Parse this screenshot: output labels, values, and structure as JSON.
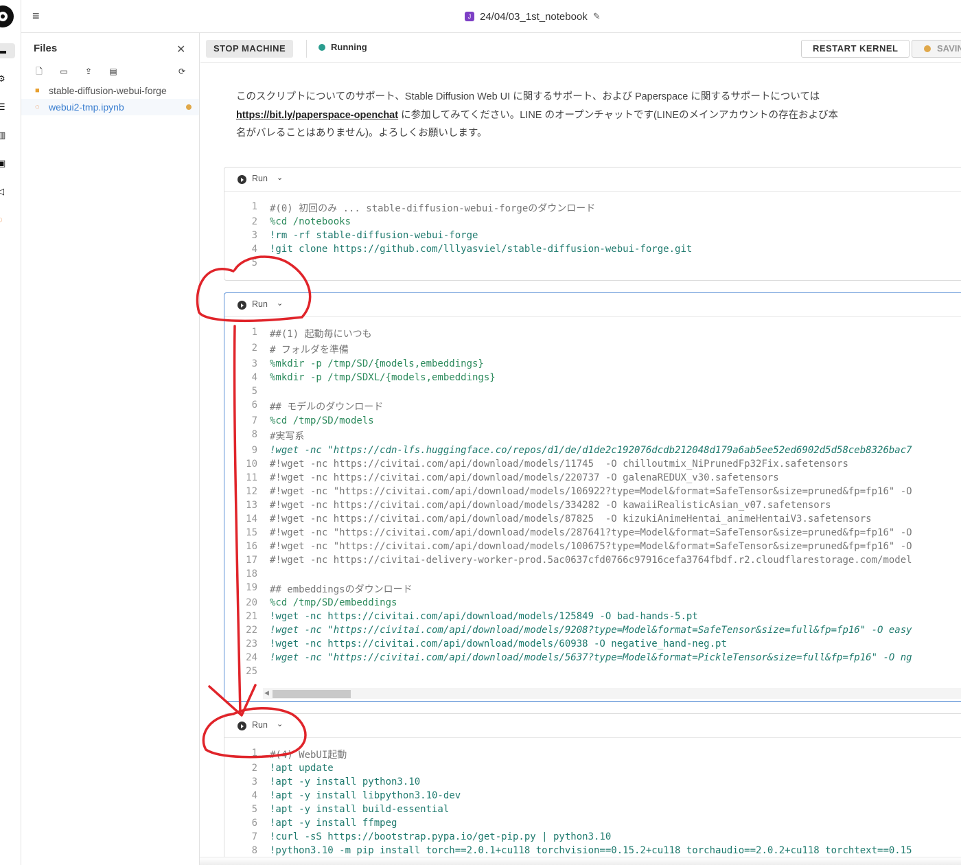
{
  "header": {
    "notebook_badge": "J",
    "notebook_title": "24/04/03_1st_notebook"
  },
  "rail": {
    "icons": [
      "files-icon",
      "cpu-icon",
      "layers-icon",
      "metrics-icon",
      "terminal-icon",
      "vscode-icon",
      "jupyter-icon"
    ]
  },
  "files": {
    "title": "Files",
    "items": [
      {
        "name": "stable-diffusion-webui-forge",
        "type": "folder"
      },
      {
        "name": "webui2-tmp.ipynb",
        "type": "notebook",
        "unsaved": true
      }
    ]
  },
  "toolbar": {
    "stop_label": "STOP MACHINE",
    "status_label": "Running",
    "restart_label": "RESTART KERNEL",
    "save_label": "SAVING"
  },
  "markdown": {
    "line1": "このスクリプトについてのサポート、Stable Diffusion Web UI に関するサポート、および Paperspace に関するサポートについては",
    "link": "https://bit.ly/paperspace-openchat",
    "line2_rest": " に参加してみてください。LINE のオープンチャットです(LINEのメインアカウントの存在および本",
    "line3": "名がバレることはありません)。よろしくお願いします。"
  },
  "cells": [
    {
      "run_label": "Run",
      "lines": [
        {
          "n": "1",
          "t": "#(0) 初回のみ ... stable-diffusion-webui-forgeのダウンロード",
          "k": "comment"
        },
        {
          "n": "2",
          "t": "%cd /notebooks",
          "k": "magic"
        },
        {
          "n": "3",
          "t": "!rm -rf stable-diffusion-webui-forge",
          "k": "bang"
        },
        {
          "n": "4",
          "t": "!git clone https://github.com/lllyasviel/stable-diffusion-webui-forge.git",
          "k": "bang"
        },
        {
          "n": "5",
          "t": "",
          "k": ""
        }
      ]
    },
    {
      "run_label": "Run",
      "lines": [
        {
          "n": "1",
          "t": "##(1) 起動毎にいつも",
          "k": "comment"
        },
        {
          "n": "2",
          "t": "# フォルダを準備",
          "k": "comment"
        },
        {
          "n": "3",
          "t": "%mkdir -p /tmp/SD/{models,embeddings}",
          "k": "magic"
        },
        {
          "n": "4",
          "t": "%mkdir -p /tmp/SDXL/{models,embeddings}",
          "k": "magic"
        },
        {
          "n": "5",
          "t": "",
          "k": ""
        },
        {
          "n": "6",
          "t": "## モデルのダウンロード",
          "k": "comment"
        },
        {
          "n": "7",
          "t": "%cd /tmp/SD/models",
          "k": "magic"
        },
        {
          "n": "8",
          "t": "#実写系",
          "k": "comment"
        },
        {
          "n": "9",
          "t": "!wget -nc \"https://cdn-lfs.huggingface.co/repos/d1/de/d1de2c192076dcdb212048d179a6ab5ee52ed6902d5d58ceb8326bac7",
          "k": "italic"
        },
        {
          "n": "10",
          "t": "#!wget -nc https://civitai.com/api/download/models/11745  -O chilloutmix_NiPrunedFp32Fix.safetensors",
          "k": "comment"
        },
        {
          "n": "11",
          "t": "#!wget -nc https://civitai.com/api/download/models/220737 -O galenaREDUX_v30.safetensors",
          "k": "comment"
        },
        {
          "n": "12",
          "t": "#!wget -nc \"https://civitai.com/api/download/models/106922?type=Model&format=SafeTensor&size=pruned&fp=fp16\" -O",
          "k": "comment"
        },
        {
          "n": "13",
          "t": "#!wget -nc https://civitai.com/api/download/models/334282 -O kawaiiRealisticAsian_v07.safetensors",
          "k": "comment"
        },
        {
          "n": "14",
          "t": "#!wget -nc https://civitai.com/api/download/models/87825  -O kizukiAnimeHentai_animeHentaiV3.safetensors",
          "k": "comment"
        },
        {
          "n": "15",
          "t": "#!wget -nc \"https://civitai.com/api/download/models/287641?type=Model&format=SafeTensor&size=pruned&fp=fp16\" -O",
          "k": "comment"
        },
        {
          "n": "16",
          "t": "#!wget -nc \"https://civitai.com/api/download/models/100675?type=Model&format=SafeTensor&size=pruned&fp=fp16\" -O",
          "k": "comment"
        },
        {
          "n": "17",
          "t": "#!wget -nc https://civitai-delivery-worker-prod.5ac0637cfd0766c97916cefa3764fbdf.r2.cloudflarestorage.com/model",
          "k": "comment"
        },
        {
          "n": "18",
          "t": "",
          "k": ""
        },
        {
          "n": "19",
          "t": "## embeddingsのダウンロード",
          "k": "comment"
        },
        {
          "n": "20",
          "t": "%cd /tmp/SD/embeddings",
          "k": "magic"
        },
        {
          "n": "21",
          "t": "!wget -nc https://civitai.com/api/download/models/125849 -O bad-hands-5.pt",
          "k": "bang"
        },
        {
          "n": "22",
          "t": "!wget -nc \"https://civitai.com/api/download/models/9208?type=Model&format=SafeTensor&size=full&fp=fp16\" -O easy",
          "k": "italic"
        },
        {
          "n": "23",
          "t": "!wget -nc https://civitai.com/api/download/models/60938 -O negative_hand-neg.pt",
          "k": "bang"
        },
        {
          "n": "24",
          "t": "!wget -nc \"https://civitai.com/api/download/models/5637?type=Model&format=PickleTensor&size=full&fp=fp16\" -O ng",
          "k": "italic"
        },
        {
          "n": "25",
          "t": "",
          "k": ""
        }
      ]
    },
    {
      "run_label": "Run",
      "lines": [
        {
          "n": "1",
          "t": "#(4) WebUI起動",
          "k": "comment"
        },
        {
          "n": "2",
          "t": "!apt update",
          "k": "bang"
        },
        {
          "n": "3",
          "t": "!apt -y install python3.10",
          "k": "bang"
        },
        {
          "n": "4",
          "t": "!apt -y install libpython3.10-dev",
          "k": "bang"
        },
        {
          "n": "5",
          "t": "!apt -y install build-essential",
          "k": "bang"
        },
        {
          "n": "6",
          "t": "!apt -y install ffmpeg",
          "k": "bang"
        },
        {
          "n": "7",
          "t": "!curl -sS https://bootstrap.pypa.io/get-pip.py | python3.10",
          "k": "bang"
        },
        {
          "n": "8",
          "t": "!python3.10 -m pip install torch==2.0.1+cu118 torchvision==0.15.2+cu118 torchaudio==2.0.2+cu118 torchtext==0.15",
          "k": "bang"
        }
      ]
    }
  ],
  "colors": {
    "accent": "#5a8fd6",
    "running": "#2a9d8f",
    "unsaved": "#e0a84a",
    "annotation": "#e0242a"
  }
}
